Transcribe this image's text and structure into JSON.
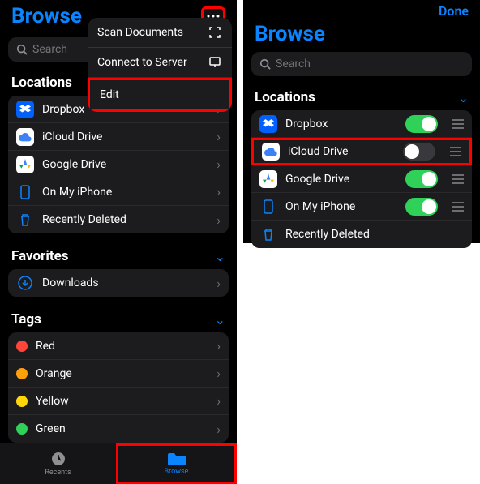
{
  "left": {
    "title": "Browse",
    "searchPlaceholder": "Search",
    "menu": {
      "scan": "Scan Documents",
      "connect": "Connect to Server",
      "edit": "Edit"
    },
    "locations": {
      "header": "Locations",
      "items": [
        {
          "label": "Dropbox"
        },
        {
          "label": "iCloud Drive"
        },
        {
          "label": "Google Drive"
        },
        {
          "label": "On My iPhone"
        },
        {
          "label": "Recently Deleted"
        }
      ]
    },
    "favorites": {
      "header": "Favorites",
      "items": [
        {
          "label": "Downloads"
        }
      ]
    },
    "tags": {
      "header": "Tags",
      "items": [
        {
          "label": "Red",
          "color": "#ff453a"
        },
        {
          "label": "Orange",
          "color": "#ff9f0a"
        },
        {
          "label": "Yellow",
          "color": "#ffd60a"
        },
        {
          "label": "Green",
          "color": "#30d158"
        }
      ]
    },
    "tabs": {
      "recents": "Recents",
      "browse": "Browse"
    }
  },
  "right": {
    "done": "Done",
    "title": "Browse",
    "searchPlaceholder": "Search",
    "locations": {
      "header": "Locations",
      "items": [
        {
          "label": "Dropbox",
          "on": true
        },
        {
          "label": "iCloud Drive",
          "on": false
        },
        {
          "label": "Google Drive",
          "on": true
        },
        {
          "label": "On My iPhone",
          "on": true
        },
        {
          "label": "Recently Deleted"
        }
      ]
    }
  }
}
